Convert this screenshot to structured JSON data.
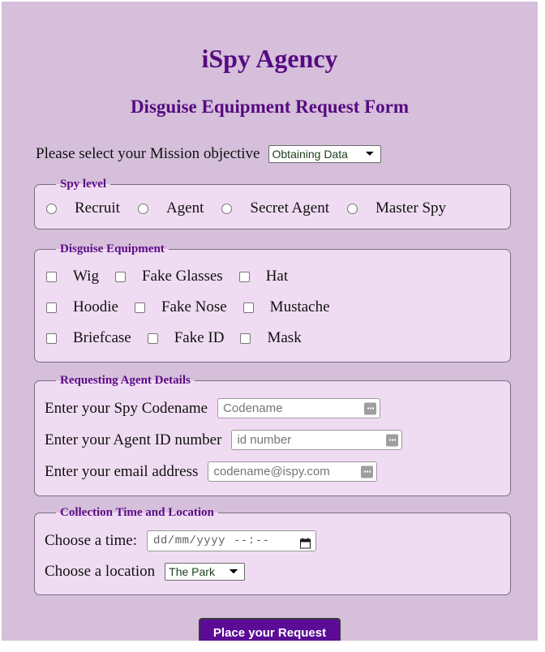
{
  "page": {
    "title": "iSpy Agency",
    "subtitle": "Disguise Equipment Request Form",
    "background_color": "#d5bfda",
    "panel_color": "#f0dcf2",
    "accent_color": "#560b81",
    "button_color": "#5b0b96"
  },
  "mission": {
    "label": "Please select your Mission objective",
    "selected": "Obtaining Data",
    "options": [
      "Obtaining Data"
    ]
  },
  "spy_level": {
    "legend": "Spy level",
    "options": [
      {
        "label": "Recruit",
        "checked": false
      },
      {
        "label": "Agent",
        "checked": false
      },
      {
        "label": "Secret Agent",
        "checked": false
      },
      {
        "label": "Master Spy",
        "checked": false
      }
    ]
  },
  "equipment": {
    "legend": "Disguise Equipment",
    "rows": [
      [
        {
          "label": "Wig",
          "checked": false
        },
        {
          "label": "Fake Glasses",
          "checked": false
        },
        {
          "label": "Hat",
          "checked": false
        }
      ],
      [
        {
          "label": "Hoodie",
          "checked": false
        },
        {
          "label": "Fake Nose",
          "checked": false
        },
        {
          "label": "Mustache",
          "checked": false
        }
      ],
      [
        {
          "label": "Briefcase",
          "checked": false
        },
        {
          "label": "Fake ID",
          "checked": false
        },
        {
          "label": "Mask",
          "checked": false
        }
      ]
    ]
  },
  "agent_details": {
    "legend": "Requesting Agent Details",
    "codename": {
      "label": "Enter your Spy Codename",
      "placeholder": "Codename",
      "value": ""
    },
    "agent_id": {
      "label": "Enter your Agent ID number",
      "placeholder": "id number",
      "value": ""
    },
    "email": {
      "label": "Enter your email address",
      "placeholder": "codename@ispy.com",
      "value": ""
    }
  },
  "collection": {
    "legend": "Collection Time and Location",
    "time": {
      "label": "Choose a time:",
      "date_placeholder": "dd/mm/yyyy",
      "time_placeholder": "--:--"
    },
    "location": {
      "label": "Choose a location",
      "selected": "The Park",
      "options": [
        "The Park"
      ]
    }
  },
  "submit": {
    "label": "Place your Request"
  }
}
